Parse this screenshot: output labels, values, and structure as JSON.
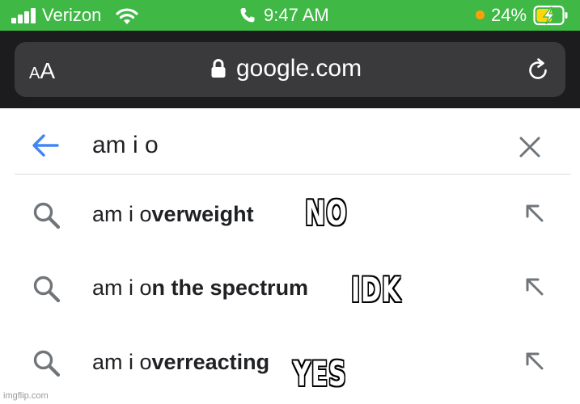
{
  "colors": {
    "status_bar": "#3fb845",
    "browser_bar": "#1c1c1e",
    "url_pill": "#3a3a3c",
    "back_arrow": "#4285f4",
    "icon_gray": "#70757a",
    "battery_fill": "#ffd60a",
    "privacy_dot": "#ff9f0a"
  },
  "status_bar": {
    "carrier": "Verizon",
    "time": "9:47 AM",
    "battery_percent": "24%",
    "battery_level": 0.24,
    "charging": true,
    "icons": [
      "signal-icon",
      "wifi-icon",
      "phone-icon",
      "privacy-dot",
      "battery-charging-icon"
    ]
  },
  "browser": {
    "text_size_small": "A",
    "text_size_large": "A",
    "url": "google.com",
    "icons": [
      "lock-icon",
      "reload-icon"
    ]
  },
  "search": {
    "query": "am i o",
    "icons": [
      "back-arrow-icon",
      "clear-icon"
    ]
  },
  "suggestions": [
    {
      "typed": "am i o",
      "completion": "verweight"
    },
    {
      "typed": "am i o",
      "completion": "n the spectrum"
    },
    {
      "typed": "am i o",
      "completion": "verreacting"
    }
  ],
  "captions": [
    "NO",
    "IDK",
    "YES"
  ],
  "watermark": "imgflip.com"
}
